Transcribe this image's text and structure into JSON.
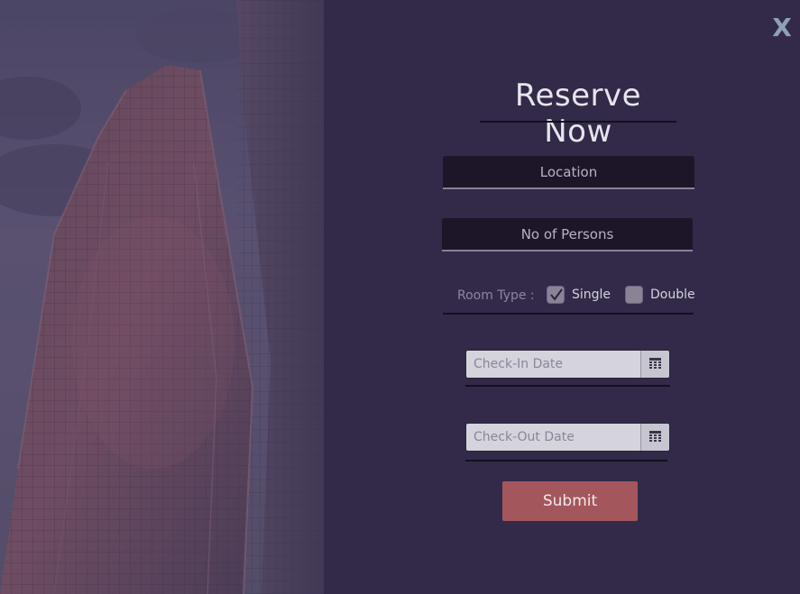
{
  "window": {
    "close_label": "X"
  },
  "form": {
    "title": "Reserve Now",
    "location_placeholder": "Location",
    "persons_placeholder": "No of Persons",
    "room_type_label": "Room Type :",
    "room_options": [
      {
        "label": "Single",
        "checked": true
      },
      {
        "label": "Double",
        "checked": false
      }
    ],
    "checkin_placeholder": "Check-In Date",
    "checkout_placeholder": "Check-Out Date",
    "submit_label": "Submit"
  },
  "icons": {
    "close": "close-icon",
    "calendar": "calendar-icon",
    "checkmark": "checkmark-icon"
  },
  "colors": {
    "background": "#322a48",
    "field_bg": "#1c1628",
    "submit_bg": "#a3575c",
    "title": "#e8e4ee"
  }
}
